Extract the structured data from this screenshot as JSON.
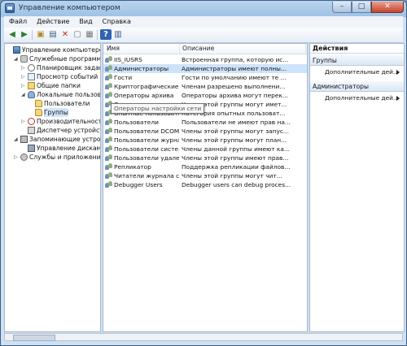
{
  "window": {
    "title": "Управление компьютером"
  },
  "titlebar_buttons": {
    "minimize": "–",
    "maximize": "□",
    "close": "✕"
  },
  "menu": [
    "Файл",
    "Действие",
    "Вид",
    "Справка"
  ],
  "toolbar_icons": [
    "back-icon",
    "forward-icon",
    "up-folder-icon",
    "show-hide-tree-icon",
    "delete-icon",
    "properties-icon",
    "export-icon",
    "help-icon",
    "show-hide-actions-icon"
  ],
  "tree": [
    {
      "label": "Управление компьютером (л",
      "icon": "computer-icon",
      "indent": 0,
      "exp": ""
    },
    {
      "label": "Служебные программы",
      "icon": "tools-icon",
      "indent": 1,
      "exp": "◢"
    },
    {
      "label": "Планировщик заданий",
      "icon": "clock-icon",
      "indent": 2,
      "exp": "▷"
    },
    {
      "label": "Просмотр событий",
      "icon": "event-log-icon",
      "indent": 2,
      "exp": "▷"
    },
    {
      "label": "Общие папки",
      "icon": "shared-folder-icon",
      "indent": 2,
      "exp": "▷"
    },
    {
      "label": "Локальные пользовате",
      "icon": "users-icon",
      "indent": 2,
      "exp": "◢"
    },
    {
      "label": "Пользователи",
      "icon": "folder-icon",
      "indent": 3,
      "exp": ""
    },
    {
      "label": "Группы",
      "icon": "folder-icon",
      "indent": 3,
      "exp": "",
      "selected": true
    },
    {
      "label": "Производительность",
      "icon": "performance-icon",
      "indent": 2,
      "exp": "▷"
    },
    {
      "label": "Диспетчер устройств",
      "icon": "device-manager-icon",
      "indent": 2,
      "exp": ""
    },
    {
      "label": "Запоминающие устройств",
      "icon": "storage-icon",
      "indent": 1,
      "exp": "◢"
    },
    {
      "label": "Управление дисками",
      "icon": "disk-icon",
      "indent": 2,
      "exp": ""
    },
    {
      "label": "Службы и приложения",
      "icon": "services-icon",
      "indent": 1,
      "exp": "▷"
    }
  ],
  "list": {
    "columns": [
      "Имя",
      "Описание"
    ],
    "rows": [
      {
        "name": "IIS_IUSRS",
        "desc": "Встроенная группа, которую ис..."
      },
      {
        "name": "Администраторы",
        "desc": "Администраторы имеют полны...",
        "selected": true
      },
      {
        "name": "Гости",
        "desc": "Гости по умолчанию имеют те ..."
      },
      {
        "name": "Криптографические ...",
        "desc": "Членам разрешено выполнени..."
      },
      {
        "name": "Операторы архива",
        "desc": "Операторы архива могут перек..."
      },
      {
        "name": "Операторы настр...",
        "desc": "Члены этой группы могут имет..."
      },
      {
        "name": "Опытные пользовате...",
        "desc": "Категория опытных пользоват..."
      },
      {
        "name": "Пользователи",
        "desc": "Пользователи не имеют прав на..."
      },
      {
        "name": "Пользователи DCOM",
        "desc": "Члены этой группы могут запус..."
      },
      {
        "name": "Пользователи журна...",
        "desc": "Члены этой группы могут план..."
      },
      {
        "name": "Пользователи систе...",
        "desc": "Члены данной группы имеют ка..."
      },
      {
        "name": "Пользователи удале...",
        "desc": "Члены этой группы имеют прав..."
      },
      {
        "name": "Репликатор",
        "desc": "Поддержка репликации файлов..."
      },
      {
        "name": "Читатели журнала с...",
        "desc": "Члены этой группы могут чит..."
      },
      {
        "name": "Debugger Users",
        "desc": "Debugger users can debug proces..."
      }
    ],
    "tooltip": "Операторы настройки сети"
  },
  "actions": {
    "title": "Действия",
    "sections": [
      {
        "label": "Группы",
        "item": "Дополнительные дей..."
      },
      {
        "label": "Администраторы",
        "item": "Дополнительные дей..."
      }
    ]
  }
}
